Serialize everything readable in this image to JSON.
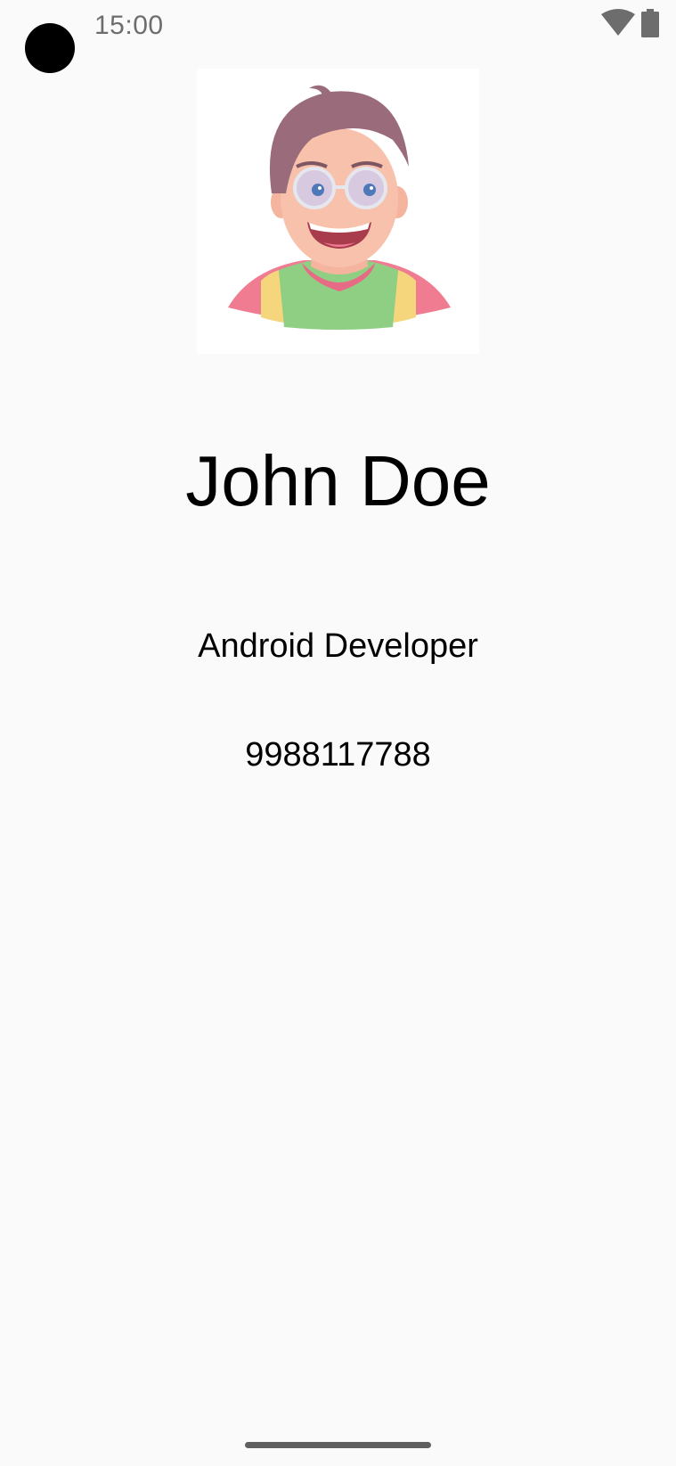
{
  "status_bar": {
    "time": "15:00",
    "icons": [
      "camera-dot",
      "wifi-icon",
      "battery-icon"
    ]
  },
  "profile": {
    "avatar_icon": "avatar-illustration",
    "name": "John Doe",
    "title": "Android Developer",
    "phone": "9988117788"
  },
  "colors": {
    "background": "#fafafa",
    "text": "#000000",
    "status_text": "#6d6d6d"
  }
}
